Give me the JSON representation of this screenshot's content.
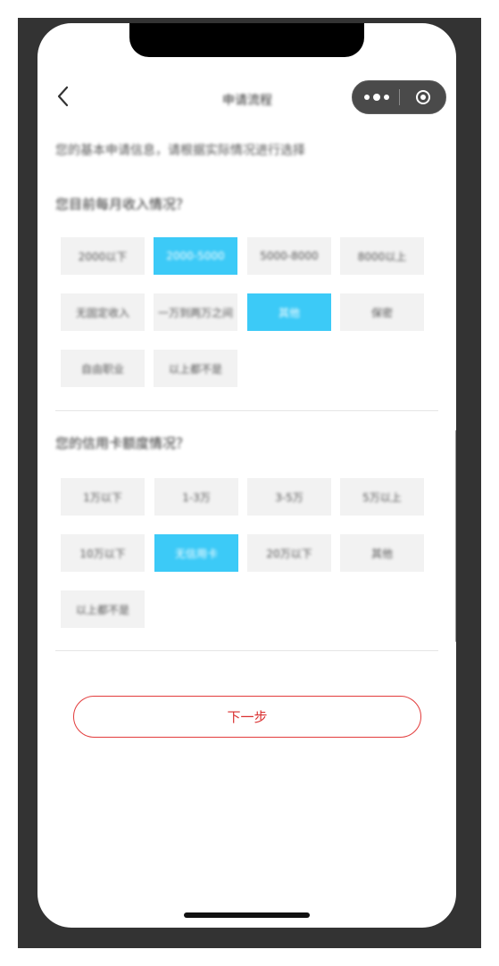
{
  "nav": {
    "title": "申请流程",
    "back_icon": "chevron-left-icon",
    "more_icon": "more-dots-icon",
    "close_icon": "target-close-icon"
  },
  "intro": "您的基本申请信息，请根据实际情况进行选择",
  "question1": {
    "title": "您目前每月收入情况？",
    "options": [
      {
        "label": "2000以下",
        "selected": false
      },
      {
        "label": "2000-5000",
        "selected": true
      },
      {
        "label": "5000-8000",
        "selected": false
      },
      {
        "label": "8000以上",
        "selected": false
      },
      {
        "label": "无固定收入",
        "selected": false
      },
      {
        "label": "一万到两万之间",
        "selected": false
      },
      {
        "label": "其他",
        "selected": true
      },
      {
        "label": "保密",
        "selected": false
      },
      {
        "label": "自由职业",
        "selected": false
      },
      {
        "label": "以上都不是",
        "selected": false
      }
    ]
  },
  "question2": {
    "title": "您的信用卡额度情况？",
    "options": [
      {
        "label": "1万以下",
        "selected": false
      },
      {
        "label": "1-3万",
        "selected": false
      },
      {
        "label": "3-5万",
        "selected": false
      },
      {
        "label": "5万以上",
        "selected": false
      },
      {
        "label": "10万以下",
        "selected": false
      },
      {
        "label": "无信用卡",
        "selected": true
      },
      {
        "label": "20万以下",
        "selected": false
      },
      {
        "label": "其他",
        "selected": false
      },
      {
        "label": "以上都不是",
        "selected": false
      }
    ]
  },
  "next_button": "下一步",
  "colors": {
    "selected": "#3ccaf7",
    "option_bg": "#f2f2f2",
    "accent_red": "#d92e2e",
    "frame": "#333333"
  }
}
